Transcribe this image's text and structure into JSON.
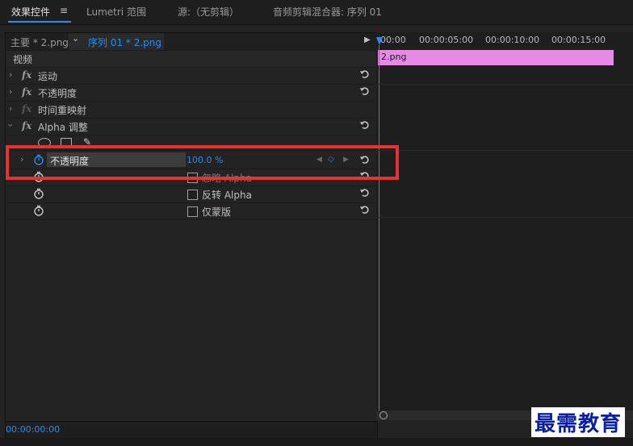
{
  "tabs": {
    "effect_controls": "效果控件",
    "menu_glyph": "≡",
    "lumetri": "Lumetri 范围",
    "source": "源:（无剪辑）",
    "mixer": "音频剪辑混合器: 序列 01"
  },
  "panel_header": {
    "master": "主要 * 2.png",
    "sequence": "序列 01 * 2.png",
    "chevron": "⌄",
    "play": "▶"
  },
  "section": {
    "video": "视频"
  },
  "effects": [
    {
      "fx": "fx",
      "label": "运动"
    },
    {
      "fx": "fx",
      "label": "不透明度"
    },
    {
      "fx": "fx",
      "label": "时间重映射"
    },
    {
      "fx": "fx",
      "label": "Alpha 调整"
    }
  ],
  "alpha_params": {
    "opacity_label": "不透明度",
    "opacity_value": "100.0 %",
    "ignore_alpha": "忽略 Alpha",
    "invert_alpha": "反转 Alpha",
    "mask_only": "仅蒙版"
  },
  "timeline": {
    "ticks": [
      "00:00",
      "00:00:05:00",
      "00:00:10:00",
      "00:00:15:00"
    ],
    "clip_name": "2.png"
  },
  "timecode": "00:00:00:00",
  "watermark": "最需教育",
  "colors": {
    "accent": "#2d8ceb",
    "clip": "#e58be5",
    "highlight": "#e63232",
    "background": "#232323"
  }
}
